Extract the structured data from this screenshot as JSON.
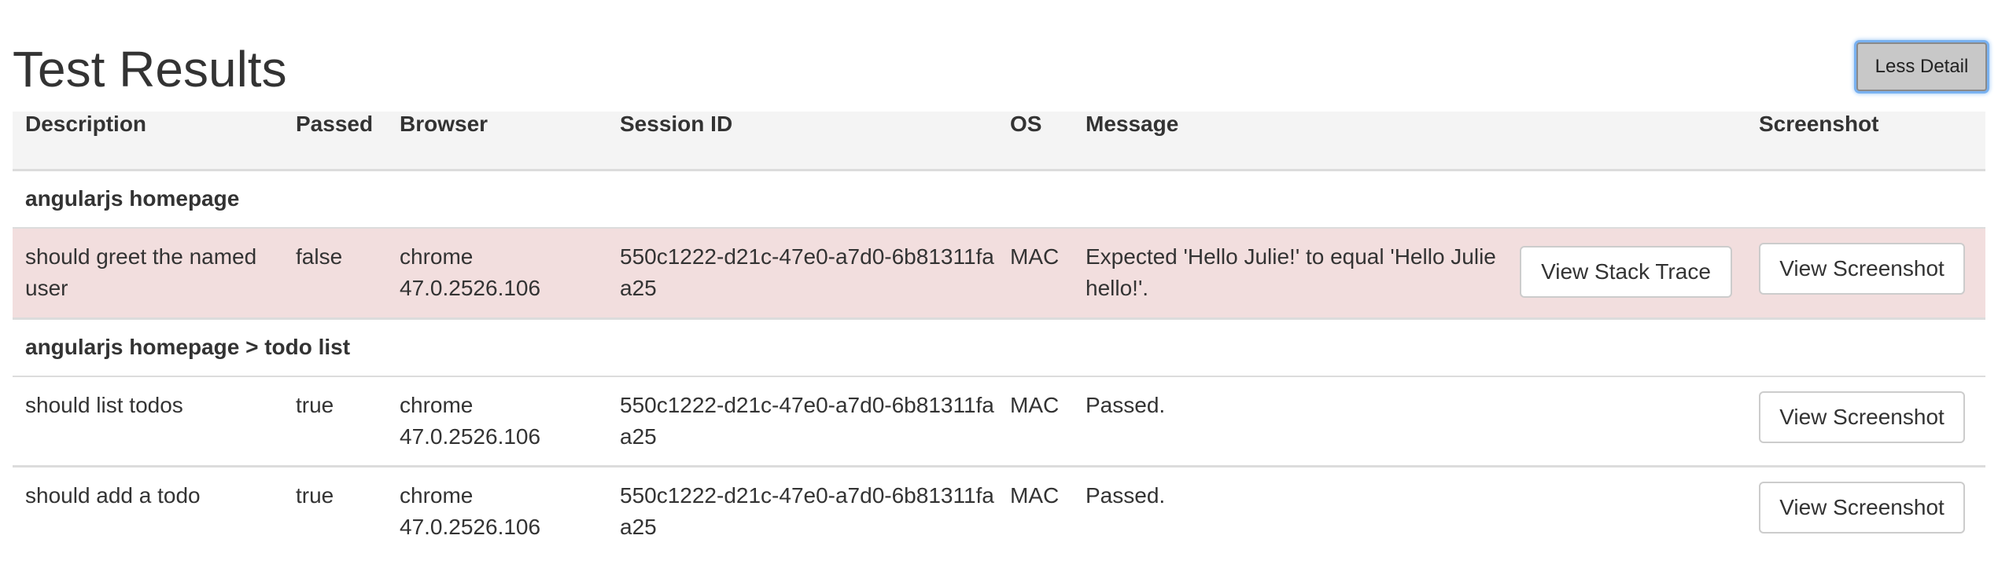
{
  "page": {
    "title": "Test Results",
    "toggle_label": "Less Detail"
  },
  "table": {
    "headers": {
      "description": "Description",
      "passed": "Passed",
      "browser": "Browser",
      "session_id": "Session ID",
      "os": "OS",
      "message": "Message",
      "screenshot": "Screenshot"
    },
    "groups": [
      {
        "name": "angularjs homepage",
        "rows": [
          {
            "description": "should greet the named user",
            "passed": "false",
            "browser": "chrome 47.0.2526.106",
            "session_id": "550c1222-d21c-47e0-a7d0-6b81311faa25",
            "os": "MAC",
            "message": "Expected 'Hello Julie!' to equal 'Hello Julie hello!'.",
            "stack_trace_label": "View Stack Trace",
            "screenshot_label": "View Screenshot"
          }
        ]
      },
      {
        "name": "angularjs homepage > todo list",
        "rows": [
          {
            "description": "should list todos",
            "passed": "true",
            "browser": "chrome 47.0.2526.106",
            "session_id": "550c1222-d21c-47e0-a7d0-6b81311faa25",
            "os": "MAC",
            "message": "Passed.",
            "screenshot_label": "View Screenshot"
          },
          {
            "description": "should add a todo",
            "passed": "true",
            "browser": "chrome 47.0.2526.106",
            "session_id": "550c1222-d21c-47e0-a7d0-6b81311faa25",
            "os": "MAC",
            "message": "Passed.",
            "screenshot_label": "View Screenshot"
          }
        ]
      }
    ]
  },
  "colors": {
    "failed_row_bg": "#f2dede",
    "header_bg": "#f4f4f4",
    "focus_ring": "#79b1f0"
  }
}
